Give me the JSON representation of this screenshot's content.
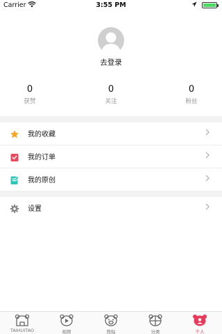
{
  "status_bar": {
    "carrier": "Carrier",
    "time": "3:55 PM",
    "battery_level": 1.0
  },
  "profile": {
    "login_label": "去登录"
  },
  "stats": [
    {
      "value": "0",
      "label": "获赞"
    },
    {
      "value": "0",
      "label": "关注"
    },
    {
      "value": "0",
      "label": "粉丝"
    }
  ],
  "menu": [
    {
      "label": "我的收藏",
      "icon": "star-icon",
      "color": "#f5a623"
    },
    {
      "label": "我的订单",
      "icon": "order-icon",
      "color": "#e84a5f"
    },
    {
      "label": "我的原创",
      "icon": "original-icon",
      "color": "#2ec4b6"
    }
  ],
  "settings": {
    "label": "设置",
    "icon": "gear-icon"
  },
  "tabbar": [
    {
      "label": "TAIHUITAO",
      "icon": "taihuitao-bear-icon"
    },
    {
      "label": "视频",
      "icon": "video-bear-icon"
    },
    {
      "label": "熊贴",
      "icon": "post-bear-icon"
    },
    {
      "label": "分类",
      "icon": "category-bear-icon"
    },
    {
      "label": "个人",
      "icon": "profile-bear-icon",
      "active": true,
      "color": "#e83a5c"
    }
  ]
}
